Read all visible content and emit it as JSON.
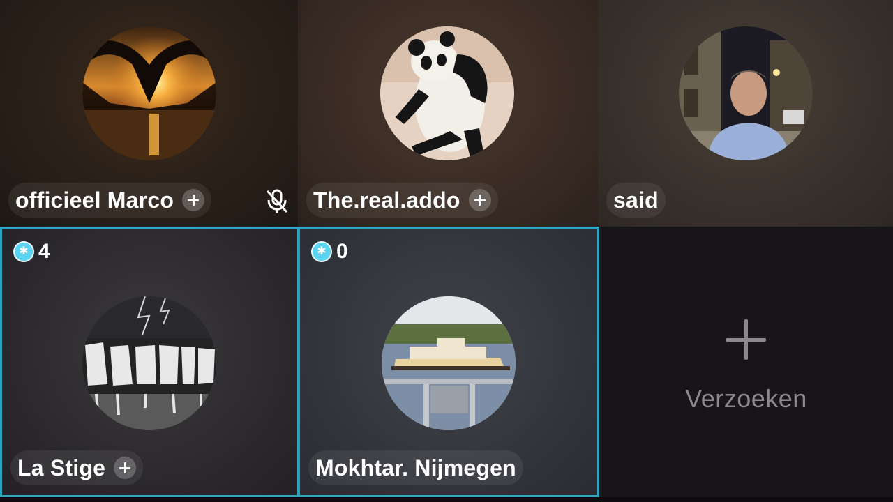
{
  "tiles": [
    {
      "name": "officieel Marco",
      "follow_icon": "plus-icon",
      "mic_state": "muted",
      "mic_icon": "mic-muted-icon"
    },
    {
      "name": "The.real.addo",
      "follow_icon": "plus-icon"
    },
    {
      "name": "said"
    },
    {
      "name": "La Stige",
      "follow_icon": "plus-icon",
      "score": "4",
      "score_icon": "gift-badge-icon",
      "highlighted": true
    },
    {
      "name": "Mokhtar. Nijmegen",
      "score": "0",
      "score_icon": "gift-badge-icon",
      "highlighted": true
    }
  ],
  "requests": {
    "label": "Verzoeken",
    "icon": "plus-icon"
  },
  "colors": {
    "highlight_border": "#2aa6c0",
    "score_badge": "#5ad4f0",
    "request_text": "#8b8890"
  }
}
